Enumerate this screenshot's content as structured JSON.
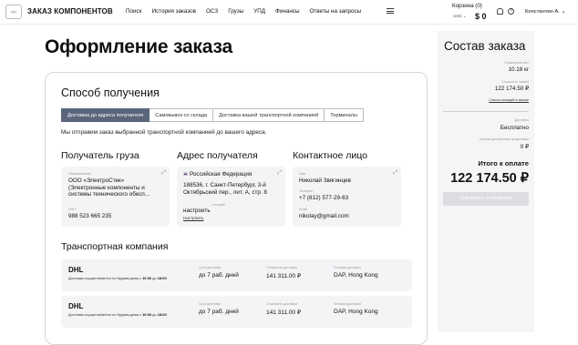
{
  "header": {
    "logo_text": "logo",
    "brand": "ЗАКАЗ КОМПОНЕНТОВ",
    "nav": [
      "Поиск",
      "История заказов",
      "ОСЗ",
      "Грузы",
      "УПД",
      "Финансы",
      "Ответы на запросы"
    ],
    "cart_label": "Корзина (0)",
    "currency": "USD",
    "cart_sum": "$ 0",
    "user": "Константин А."
  },
  "page": {
    "title": "Оформление заказа"
  },
  "delivery": {
    "title": "Способ получения",
    "tabs": [
      "Доставка до адреса получателя",
      "Самовывоз со склада",
      "Доставка вашей транспортной компанией",
      "Терминалы"
    ],
    "active_tab": 0,
    "note": "Мы отправим заказ выбранной транспортной компанией до вашего адреса."
  },
  "recipient": {
    "title": "Получатель груза",
    "name_label": "Наименование",
    "name": "ООО «ЭлектроСтек» (Электронные компоненты и системы технического обесп...",
    "inn_label": "ИНН",
    "inn": "988 523 665 235"
  },
  "address": {
    "title": "Адрес получателя",
    "country": "Российская Федерация",
    "address": "188536, г. Санкт-Петербург, 3-й Октябрьский пер., лит. А, стр. 8",
    "overlap_label": "...ентарий",
    "comment": "настроить",
    "comment_link": "Настроить"
  },
  "contact": {
    "title": "Контактное лицо",
    "name_label": "Имя",
    "name": "Николай Звягинцев",
    "phone_label": "Телефон",
    "phone": "+7 (812) 577-29-63",
    "email_label": "Email",
    "email": "nikolay@gmail.com"
  },
  "transport": {
    "title": "Транспортная компания",
    "carriers": [
      {
        "name": "DHL",
        "note_pre": "Доставка осуществляется по будним дням с ",
        "time_from": "10:00",
        "note_mid": " до ",
        "time_to": "18:00",
        "term_label": "Срок доставки",
        "term": "до 7 раб. дней",
        "cost_label": "Стоимость доставки",
        "cost": "141 311.00 ₽",
        "terms_label": "Условия доставки",
        "terms": "DAP, Hong Kong"
      },
      {
        "name": "DHL",
        "note_pre": "Доставка осуществляется по будним дням с ",
        "time_from": "10:00",
        "note_mid": " до ",
        "time_to": "18:00",
        "term_label": "Срок доставки",
        "term": "до 7 раб. дней",
        "cost_label": "Стоимость доставки",
        "cost": "141 311.00 ₽",
        "terms_label": "Условия доставки",
        "terms": "DAP, Hong Kong"
      }
    ]
  },
  "summary": {
    "title": "Состав заказа",
    "weight_label": "Суммарный вес",
    "weight": "10.18 кг",
    "order_cost_label": "Стоимость заказа",
    "order_cost": "122 174.50 ₽",
    "products_link": "Список позиций в заказе",
    "delivery_label": "Доставка",
    "delivery": "Бесплатно",
    "credit_label": "Оплата доступными средствами",
    "credit": "0 ₽",
    "total_label": "Итого к оплате",
    "total": "122 174.50 ₽",
    "pay_button": "Оформить и оплатить"
  }
}
